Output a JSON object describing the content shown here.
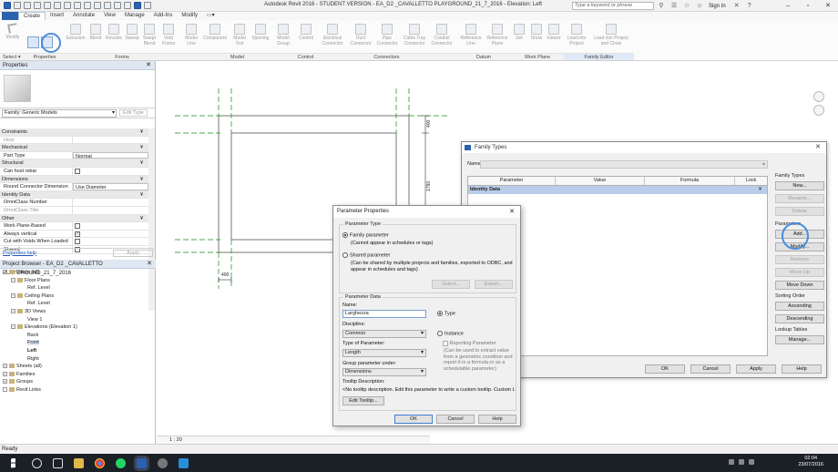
{
  "app": {
    "title": "Autodesk Revit 2016 - STUDENT VERSION -   EA_D2 _CAVALLETTO PLAYGROUND_21_7_2016 - Elevation: Left",
    "search_placeholder": "Type a keyword or phrase",
    "sign_in": "Sign In"
  },
  "ribbon": {
    "file_tab": "",
    "tabs": [
      "Create",
      "Insert",
      "Annotate",
      "View",
      "Manage",
      "Add-Ins",
      "Modify"
    ],
    "modify_label": "Modify",
    "select_label": "Select ▾",
    "properties_label": "Properties",
    "forms_buttons": [
      "Extrusion",
      "Blend",
      "Revolve",
      "Sweep",
      "Swept Blend",
      "Void Forms"
    ],
    "model_buttons": [
      "Model Line",
      "Component",
      "Model Text",
      "Opening",
      "Model Group"
    ],
    "control_buttons": [
      "Control"
    ],
    "connector_buttons": [
      "Electrical Connector",
      "Duct Connector",
      "Pipe Connector",
      "Cable Tray Connector",
      "Conduit Connector"
    ],
    "datum_buttons": [
      "Reference Line",
      "Reference Plane"
    ],
    "workplane_buttons": [
      "Set",
      "Show",
      "Viewer"
    ],
    "family_editor_buttons": [
      "Load into Project",
      "Load into Project and Close"
    ],
    "panels": [
      "Forms",
      "Model",
      "Control",
      "Connectors",
      "Datum",
      "Work Plane",
      "Family Editor"
    ]
  },
  "properties": {
    "header": "Properties",
    "family_selector": "Family: Generic Models",
    "edit_type": "Edit Type",
    "rows": [
      {
        "k": "Constraints",
        "group": true
      },
      {
        "k": "Host",
        "v": "",
        "dim": true
      },
      {
        "k": "Mechanical",
        "group": true
      },
      {
        "k": "Part Type",
        "v": "Normal"
      },
      {
        "k": "Structural",
        "group": true
      },
      {
        "k": "Can host rebar",
        "cb": ""
      },
      {
        "k": "Dimensions",
        "group": true
      },
      {
        "k": "Round Connector Dimension",
        "v": "Use Diameter"
      },
      {
        "k": "Identity Data",
        "group": true
      },
      {
        "k": "OmniClass Number",
        "v": ""
      },
      {
        "k": "OmniClass Title",
        "v": "",
        "dim": true
      },
      {
        "k": "Other",
        "group": true
      },
      {
        "k": "Work Plane-Based",
        "cb": ""
      },
      {
        "k": "Always vertical",
        "cb": "✓"
      },
      {
        "k": "Cut with Voids When Loaded",
        "cb": ""
      },
      {
        "k": "Shared",
        "cb": ""
      }
    ],
    "help_link": "Properties help",
    "apply": "Apply"
  },
  "browser": {
    "header": "Project Browser - EA_D2 _CAVALLETTO PLAYGROUND_21_7_2016",
    "items": [
      {
        "label": "Views (all)",
        "level": 0,
        "exp": "−"
      },
      {
        "label": "Floor Plans",
        "level": 1,
        "exp": "−"
      },
      {
        "label": "Ref. Level",
        "level": 3
      },
      {
        "label": "Ceiling Plans",
        "level": 1,
        "exp": "−"
      },
      {
        "label": "Ref. Level",
        "level": 3
      },
      {
        "label": "3D Views",
        "level": 1,
        "exp": "−"
      },
      {
        "label": "View 1",
        "level": 3
      },
      {
        "label": "Elevations (Elevation 1)",
        "level": 1,
        "exp": "−"
      },
      {
        "label": "Back",
        "level": 3
      },
      {
        "label": "Front",
        "level": 3,
        "hl": true
      },
      {
        "label": "Left",
        "level": 3,
        "bold": true
      },
      {
        "label": "Right",
        "level": 3
      },
      {
        "label": "Sheets (all)",
        "level": 0,
        "exp": "+"
      },
      {
        "label": "Families",
        "level": 0,
        "exp": "+"
      },
      {
        "label": "Groups",
        "level": 0,
        "exp": "+"
      },
      {
        "label": "Revit Links",
        "level": 0,
        "exp": ""
      }
    ]
  },
  "canvas": {
    "dim_top": "400",
    "dim_right": "1790",
    "dim_bottom": "400",
    "scale": "1 : 20"
  },
  "family_types": {
    "title": "Family Types",
    "name_label": "Name:",
    "columns": [
      "Parameter",
      "Value",
      "Formula",
      "Lock"
    ],
    "group_row": "Identity Data",
    "group_toggle": "¥",
    "side_sections": {
      "family_types": "Family Types",
      "parameters": "Parameters",
      "sort": "Sorting Order",
      "lookup": "Lookup Tables"
    },
    "buttons_types": [
      "New...",
      "Rename...",
      "Delete"
    ],
    "buttons_params": [
      "Add...",
      "Modify...",
      "Remove",
      "Move Up",
      "Move Down"
    ],
    "buttons_sort": [
      "Ascending",
      "Descending"
    ],
    "buttons_lookup": [
      "Manage..."
    ],
    "bottom_buttons": [
      "OK",
      "Cancel",
      "Apply",
      "Help"
    ]
  },
  "param_props": {
    "title": "Parameter Properties",
    "param_type_label": "Parameter Type",
    "family_param": "Family parameter",
    "family_param_note": "(Cannot appear in schedules or tags)",
    "shared_param": "Shared parameter",
    "shared_param_note": "(Can be shared by multiple projects and families, exported to ODBC, and appear in schedules and tags)",
    "select_btn": "Select...",
    "export_btn": "Export...",
    "param_data_label": "Parameter Data",
    "name_label": "Name:",
    "name_value": "Larghezza",
    "type_radio": "Type",
    "instance_radio": "Instance",
    "discipline_label": "Discipline:",
    "discipline_value": "Common",
    "type_of_param_label": "Type of Parameter:",
    "type_of_param_value": "Length",
    "reporting_param": "Reporting Parameter",
    "reporting_note": "(Can be used to extract value from a geometric condition and report it in a formula or as a schedulable parameter)",
    "group_label": "Group parameter under:",
    "group_value": "Dimensions",
    "tooltip_label": "Tooltip Description:",
    "tooltip_text": "<No tooltip description. Edit this parameter to write a custom tooltip. Custom t...",
    "edit_tooltip": "Edit Tooltip...",
    "ok": "OK",
    "cancel": "Cancel",
    "help": "Help"
  },
  "status": {
    "text": "Ready"
  },
  "taskbar": {
    "time": "02:04",
    "date": "23/07/2016"
  }
}
